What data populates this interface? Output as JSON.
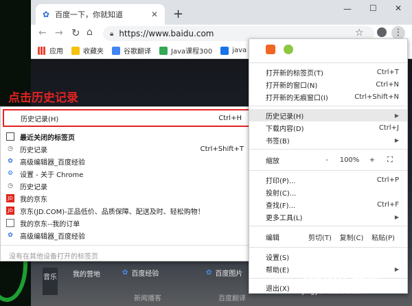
{
  "browser": {
    "tab_title": "百度一下，你就知道",
    "url": "https://www.baidu.com",
    "bookmarks": [
      "应用",
      "收藏夹",
      "谷歌翻译",
      "Java课程300",
      "java"
    ]
  },
  "annotation": "点击历史记录",
  "history_menu": {
    "header_label": "历史记录(H)",
    "header_shortcut": "Ctrl+H",
    "items": [
      {
        "icon": "window-icon",
        "label": "最近关闭的标签页",
        "shortcut": "",
        "bold": true
      },
      {
        "icon": "history-icon",
        "label": "历史记录",
        "shortcut": "Ctrl+Shift+T",
        "bold": false
      },
      {
        "icon": "paw-icon",
        "label": "高级编辑器_百度经验",
        "shortcut": "",
        "bold": false
      },
      {
        "icon": "gear-icon",
        "label": "设置 - 关于 Chrome",
        "shortcut": "",
        "bold": false
      },
      {
        "icon": "history-icon",
        "label": "历史记录",
        "shortcut": "",
        "bold": false
      },
      {
        "icon": "jd-icon",
        "label": "我的京东",
        "shortcut": "",
        "bold": false
      },
      {
        "icon": "jd-icon",
        "label": "京东(JD.COM)-正品低价、品质保障、配送及时、轻松购物！",
        "shortcut": "",
        "bold": false
      },
      {
        "icon": "page-icon",
        "label": "我的京东--我的订单",
        "shortcut": "",
        "bold": false
      },
      {
        "icon": "paw-icon",
        "label": "高级编辑器_百度经验",
        "shortcut": "",
        "bold": false
      }
    ],
    "footer": "没有在其他设备打开的标签页"
  },
  "chrome_menu": {
    "group1": [
      {
        "label": "打开新的标签页(T)",
        "shortcut": "Ctrl+T"
      },
      {
        "label": "打开新的窗口(N)",
        "shortcut": "Ctrl+N"
      },
      {
        "label": "打开新的无痕窗口(I)",
        "shortcut": "Ctrl+Shift+N"
      }
    ],
    "group2": [
      {
        "label": "历史记录(H)",
        "shortcut": "",
        "arrow": "▶"
      },
      {
        "label": "下载内容(D)",
        "shortcut": "Ctrl+J",
        "arrow": ""
      },
      {
        "label": "书签(B)",
        "shortcut": "",
        "arrow": "▶"
      }
    ],
    "zoom": {
      "label": "缩放",
      "minus": "-",
      "value": "100%",
      "plus": "+"
    },
    "group3": [
      {
        "label": "打印(P)...",
        "shortcut": "Ctrl+P",
        "arrow": ""
      },
      {
        "label": "投射(C)...",
        "shortcut": "",
        "arrow": ""
      },
      {
        "label": "查找(F)...",
        "shortcut": "Ctrl+F",
        "arrow": ""
      },
      {
        "label": "更多工具(L)",
        "shortcut": "",
        "arrow": "▶"
      }
    ],
    "edit": {
      "label": "编辑",
      "cut": "剪切(T)",
      "copy": "复制(C)",
      "paste": "粘贴(P)"
    },
    "group4": [
      {
        "label": "设置(S)",
        "shortcut": "",
        "arrow": ""
      },
      {
        "label": "帮助(E)",
        "shortcut": "",
        "arrow": "▶"
      }
    ],
    "exit": "退出(X)"
  },
  "page_tiles": {
    "music": "音乐",
    "t1": "我的营地",
    "t2": "百度经验",
    "t3": "百度图片",
    "t4": "新闻播客",
    "t5": "百度翻译"
  },
  "watermark": {
    "main": "Baidu 经验",
    "sub": "jingyan.baidu.com"
  },
  "colors": {
    "annotation": "#e32222",
    "menu_highlight": "#e8e8e8"
  }
}
